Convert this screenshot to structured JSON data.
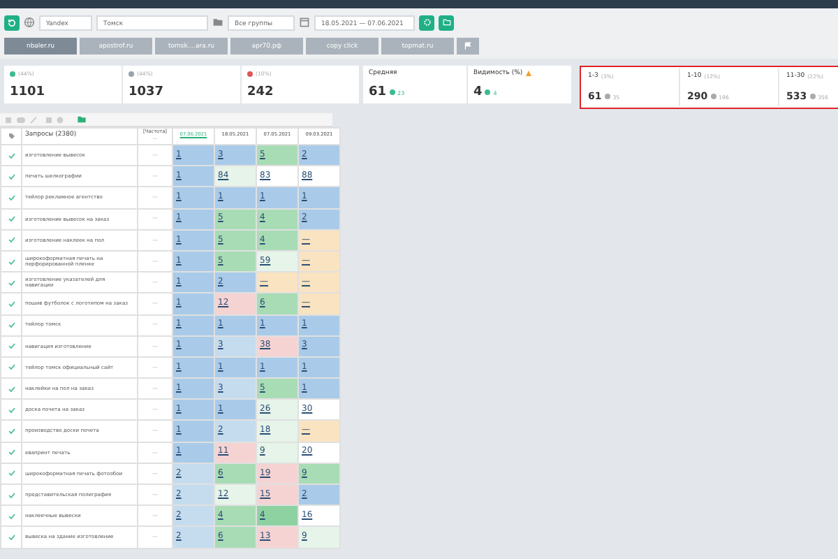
{
  "filters": {
    "engine": "Yandex",
    "region": "Томск",
    "group": "Все группы",
    "period": "18.05.2021 — 07.06.2021"
  },
  "tabs": [
    {
      "label": "nbaler.ru",
      "selected": true
    },
    {
      "label": "apostrof.ru",
      "selected": false
    },
    {
      "label": "tomsk....ara.ru",
      "selected": false
    },
    {
      "label": "apr70.рф",
      "selected": false
    },
    {
      "label": "copy click",
      "selected": false
    },
    {
      "label": "topmat.ru",
      "selected": false
    }
  ],
  "counters": [
    {
      "share": "(44%)",
      "value": "1101",
      "color": "#3dbb8f"
    },
    {
      "share": "(44%)",
      "value": "1037",
      "color": "#9aa3ab"
    },
    {
      "share": "(10%)",
      "value": "242",
      "color": "#e05656"
    }
  ],
  "average": {
    "label": "Средняя",
    "value": "61",
    "delta": "23"
  },
  "visibility": {
    "label": "Видимость (%)",
    "value": "4",
    "delta": "4",
    "warning": true
  },
  "top_ranges": [
    {
      "range": "1-3",
      "share": "(3%)",
      "value": "61",
      "previous": "35"
    },
    {
      "range": "1-10",
      "share": "(12%)",
      "value": "290",
      "previous": "196"
    },
    {
      "range": "11-30",
      "share": "(22%)",
      "value": "533",
      "previous": "356"
    }
  ],
  "table": {
    "query_header": "Запросы (2380)",
    "frequency_header": "[Частота]",
    "frequency_sub": "—",
    "dates": [
      "07.06.2021",
      "18.05.2021",
      "07.05.2021",
      "09.03.2021"
    ],
    "rows": [
      {
        "query": "изготовление вывесок",
        "frequency": "—",
        "cells": [
          {
            "value": "1",
            "color": "#a9cbe9"
          },
          {
            "value": "3",
            "color": "#a9cbe9"
          },
          {
            "value": "5",
            "color": "#a8dcb5"
          },
          {
            "value": "2",
            "color": "#a9cbe9"
          }
        ]
      },
      {
        "query": "печать шелкографии",
        "frequency": "—",
        "cells": [
          {
            "value": "1",
            "color": "#a9cbe9"
          },
          {
            "value": "84",
            "color": "#e6f4e9"
          },
          {
            "value": "83",
            "color": "#ffffff"
          },
          {
            "value": "88",
            "color": "#ffffff"
          }
        ]
      },
      {
        "query": "тейлор рекламное агентство",
        "frequency": "—",
        "cells": [
          {
            "value": "1",
            "color": "#a9cbe9"
          },
          {
            "value": "1",
            "color": "#a9cbe9"
          },
          {
            "value": "1",
            "color": "#a9cbe9"
          },
          {
            "value": "1",
            "color": "#a9cbe9"
          }
        ]
      },
      {
        "query": "изготовление вывесок на заказ",
        "frequency": "—",
        "cells": [
          {
            "value": "1",
            "color": "#a9cbe9"
          },
          {
            "value": "5",
            "color": "#a8dcb5"
          },
          {
            "value": "4",
            "color": "#a8dcb5"
          },
          {
            "value": "2",
            "color": "#a9cbe9"
          }
        ]
      },
      {
        "query": "изготовление наклеек на пол",
        "frequency": "—",
        "cells": [
          {
            "value": "1",
            "color": "#a9cbe9"
          },
          {
            "value": "5",
            "color": "#a8dcb5"
          },
          {
            "value": "4",
            "color": "#a8dcb5"
          },
          {
            "value": "—",
            "color": "#f9e3c0"
          }
        ]
      },
      {
        "query": "широкоформатная печать на перфорированной пленке",
        "frequency": "—",
        "cells": [
          {
            "value": "1",
            "color": "#a9cbe9"
          },
          {
            "value": "5",
            "color": "#a8dcb5"
          },
          {
            "value": "59",
            "color": "#e6f4e9"
          },
          {
            "value": "—",
            "color": "#f9e3c0"
          }
        ]
      },
      {
        "query": "изготовление указателей для навигации",
        "frequency": "—",
        "cells": [
          {
            "value": "1",
            "color": "#a9cbe9"
          },
          {
            "value": "2",
            "color": "#a9cbe9"
          },
          {
            "value": "—",
            "color": "#f9e3c0"
          },
          {
            "value": "—",
            "color": "#f9e3c0"
          }
        ]
      },
      {
        "query": "пошив футболок с логотипом на заказ",
        "frequency": "—",
        "cells": [
          {
            "value": "1",
            "color": "#a9cbe9"
          },
          {
            "value": "12",
            "color": "#f6d3d3"
          },
          {
            "value": "6",
            "color": "#a8dcb5"
          },
          {
            "value": "—",
            "color": "#f9e3c0"
          }
        ]
      },
      {
        "query": "тейлор томск",
        "frequency": "—",
        "cells": [
          {
            "value": "1",
            "color": "#a9cbe9"
          },
          {
            "value": "1",
            "color": "#a9cbe9"
          },
          {
            "value": "1",
            "color": "#a9cbe9"
          },
          {
            "value": "1",
            "color": "#a9cbe9"
          }
        ]
      },
      {
        "query": "навигация изготовление",
        "frequency": "—",
        "cells": [
          {
            "value": "1",
            "color": "#a9cbe9"
          },
          {
            "value": "3",
            "color": "#c5dcef"
          },
          {
            "value": "38",
            "color": "#f6d3d3"
          },
          {
            "value": "3",
            "color": "#a9cbe9"
          }
        ]
      },
      {
        "query": "тейлор томск официальный сайт",
        "frequency": "—",
        "cells": [
          {
            "value": "1",
            "color": "#a9cbe9"
          },
          {
            "value": "1",
            "color": "#a9cbe9"
          },
          {
            "value": "1",
            "color": "#a9cbe9"
          },
          {
            "value": "1",
            "color": "#a9cbe9"
          }
        ]
      },
      {
        "query": "наклейки на пол на заказ",
        "frequency": "—",
        "cells": [
          {
            "value": "1",
            "color": "#a9cbe9"
          },
          {
            "value": "3",
            "color": "#c5dcef"
          },
          {
            "value": "5",
            "color": "#a8dcb5"
          },
          {
            "value": "1",
            "color": "#a9cbe9"
          }
        ]
      },
      {
        "query": "доска почета на заказ",
        "frequency": "—",
        "cells": [
          {
            "value": "1",
            "color": "#a9cbe9"
          },
          {
            "value": "1",
            "color": "#a9cbe9"
          },
          {
            "value": "26",
            "color": "#e6f4e9"
          },
          {
            "value": "30",
            "color": "#ffffff"
          }
        ]
      },
      {
        "query": "производство доски почета",
        "frequency": "—",
        "cells": [
          {
            "value": "1",
            "color": "#a9cbe9"
          },
          {
            "value": "2",
            "color": "#c5dcef"
          },
          {
            "value": "18",
            "color": "#e6f4e9"
          },
          {
            "value": "—",
            "color": "#f9e3c0"
          }
        ]
      },
      {
        "query": "евапринт печать",
        "frequency": "—",
        "cells": [
          {
            "value": "1",
            "color": "#a9cbe9"
          },
          {
            "value": "11",
            "color": "#f6d3d3"
          },
          {
            "value": "9",
            "color": "#e6f4e9"
          },
          {
            "value": "20",
            "color": "#ffffff"
          }
        ]
      },
      {
        "query": "широкоформатная печать фотообои",
        "frequency": "—",
        "cells": [
          {
            "value": "2",
            "color": "#c5dcef"
          },
          {
            "value": "6",
            "color": "#a8dcb5"
          },
          {
            "value": "19",
            "color": "#f6d3d3"
          },
          {
            "value": "9",
            "color": "#a8dcb5"
          }
        ]
      },
      {
        "query": "представительская полиграфия",
        "frequency": "—",
        "cells": [
          {
            "value": "2",
            "color": "#c5dcef"
          },
          {
            "value": "12",
            "color": "#e6f4e9"
          },
          {
            "value": "15",
            "color": "#f6d3d3"
          },
          {
            "value": "2",
            "color": "#a9cbe9"
          }
        ]
      },
      {
        "query": "наклеечные вывески",
        "frequency": "—",
        "cells": [
          {
            "value": "2",
            "color": "#c5dcef"
          },
          {
            "value": "4",
            "color": "#a8dcb5"
          },
          {
            "value": "4",
            "color": "#8fd2a2"
          },
          {
            "value": "16",
            "color": "#ffffff"
          }
        ]
      },
      {
        "query": "вывеска на здание изготовление",
        "frequency": "—",
        "cells": [
          {
            "value": "2",
            "color": "#c5dcef"
          },
          {
            "value": "6",
            "color": "#a8dcb5"
          },
          {
            "value": "13",
            "color": "#f6d3d3"
          },
          {
            "value": "9",
            "color": "#e6f4e9"
          }
        ]
      }
    ]
  }
}
